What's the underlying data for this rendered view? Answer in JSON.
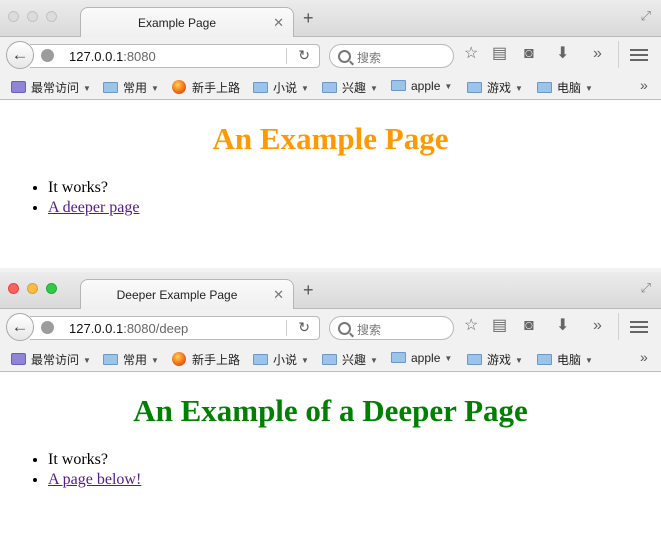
{
  "window1": {
    "tab_title": "Example Page",
    "url_host": "127.0.0.1",
    "url_rest": ":8080",
    "search_placeholder": "搜索",
    "heading": "An Example Page",
    "heading_color": "#ff9900",
    "items": [
      {
        "text": "It works?"
      },
      {
        "text": "A deeper page",
        "link": true
      }
    ]
  },
  "window2": {
    "tab_title": "Deeper Example Page",
    "url_host": "127.0.0.1",
    "url_rest": ":8080/deep",
    "search_placeholder": "搜索",
    "heading": "An Example of a Deeper Page",
    "heading_color": "#008000",
    "items": [
      {
        "text": "It works?"
      },
      {
        "text": "A page below!",
        "link": true
      }
    ]
  },
  "bookmarks": [
    {
      "label": "最常访问",
      "icon": "smart-folder-icon",
      "dropdown": true
    },
    {
      "label": "常用",
      "icon": "folder-icon",
      "dropdown": true
    },
    {
      "label": "新手上路",
      "icon": "firefox-icon",
      "dropdown": false
    },
    {
      "label": "小说",
      "icon": "folder-icon",
      "dropdown": true
    },
    {
      "label": "兴趣",
      "icon": "folder-icon",
      "dropdown": true
    },
    {
      "label": "apple",
      "icon": "folder-icon",
      "dropdown": true
    },
    {
      "label": "游戏",
      "icon": "folder-icon",
      "dropdown": true
    },
    {
      "label": "电脑",
      "icon": "folder-icon",
      "dropdown": true
    }
  ],
  "link_color": "#551a8b"
}
